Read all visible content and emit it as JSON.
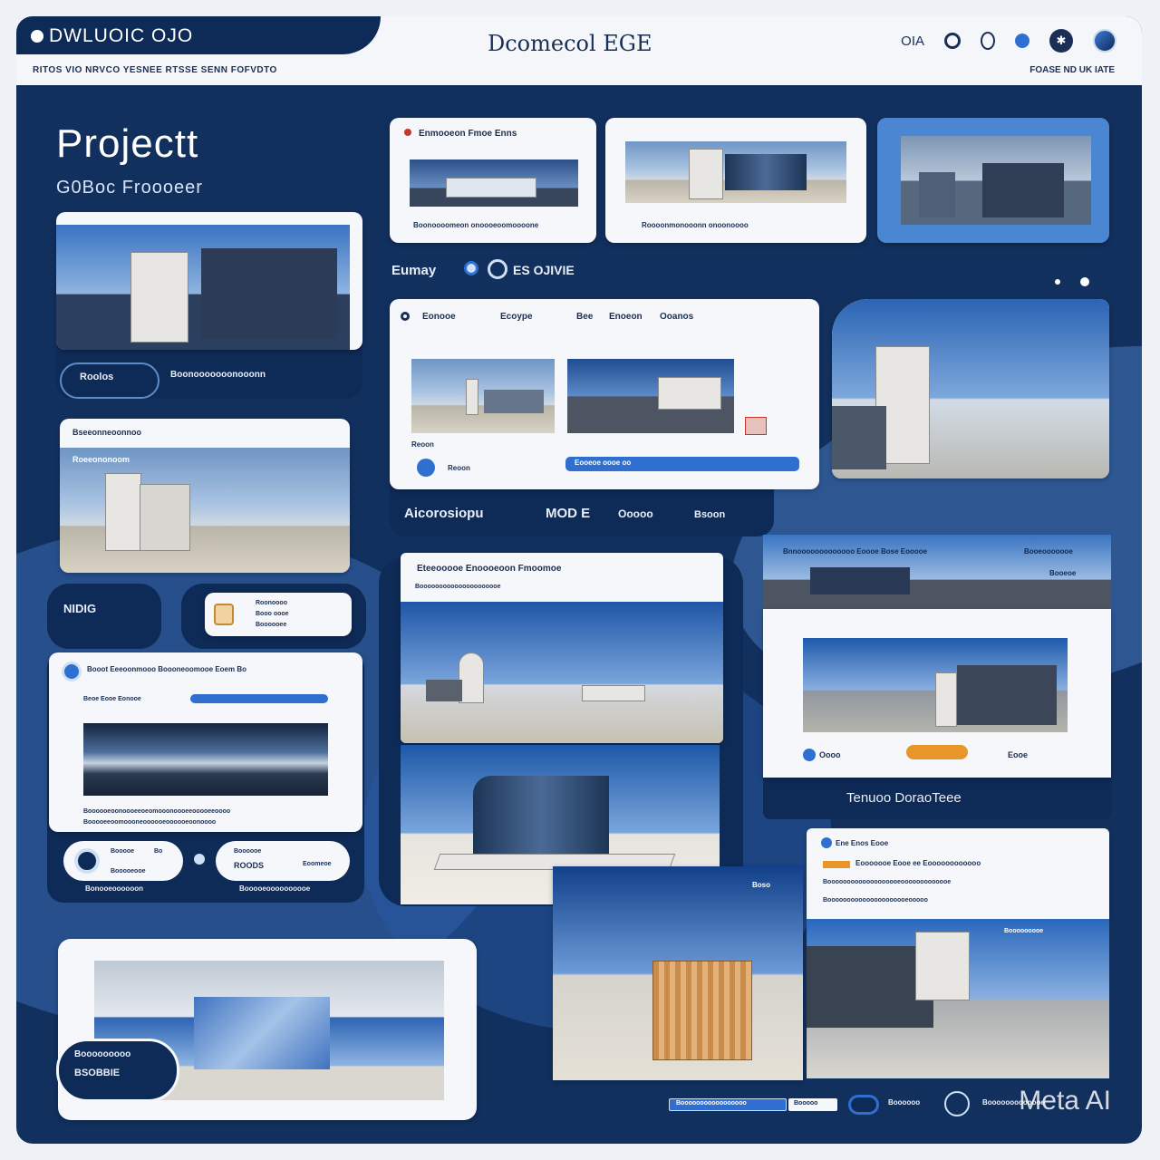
{
  "header": {
    "brand": "DWLUOIC  OJO",
    "nav": "RITOS VIO NRVCO YESNEE RTSSE SENN FOFVDTO",
    "title": "Dcomecol EGE",
    "icon_label": "OIA",
    "links": "FOASE ND UK IATE",
    "icons": [
      "user-icon",
      "circle-icon",
      "dot-icon",
      "globe-icon",
      "earth-icon"
    ]
  },
  "page": {
    "title": "Projectt",
    "subtitle": "G0Boc Froooeer"
  },
  "row_label": "Eumay",
  "row_label_icons": "ES OJIVIE",
  "cards": {
    "top1_title": "Enmooeon Fmoe Enns",
    "top1_caption": "Boonoooomeon onoooeoomoooone",
    "top2_caption": "Roooonmonooonn onoonoooo",
    "left1_caption": "Boonooooooonooonn",
    "left1_pill": "Roolos",
    "mid_tabs": [
      "Eonooe",
      "Ecoype",
      "Bee",
      "Enoeon",
      "Ooanos"
    ],
    "mid_caption": "Reoon",
    "mid_bar_text": "Eooeoe oooe oo",
    "mid_bottom": "Aicorosiopu",
    "mid_bottom_2": "MOD E",
    "mid_bottom_3": "Ooooo",
    "mid_bottom_4": "Bsoon",
    "left2_title": "Bseeonneoonnoo",
    "left2_sub": "Roeeononoom",
    "nido": "NIDIG",
    "chip_lines": [
      "Roonoooo",
      "Booo oooe",
      "Boooooee"
    ],
    "left3_title": "Booot Eeeoonmooo Boooneoomooe Eoem Bo",
    "left3_label": "Beoe Eooe Eonooe",
    "left3_lines": [
      "Boooooeoonoooeeoeomooonoooeeooooeeoooo",
      "Booooeeoomoooneoooooeoooooeoonoooo"
    ],
    "pill1_lines": [
      "Booooe",
      "Bo",
      "Booooeooe"
    ],
    "pill2_lines": [
      "Boooooe",
      "ROODS",
      "Eoomeoe"
    ],
    "pill_captions": [
      "Bonooeoooooon",
      "Booooeoooooooooe"
    ],
    "center_title": "Eteeooooe  Enoooeoon Fmoomoe",
    "center_sub": "Booooooooooooooooooooe",
    "right1_title": "Bnnooooooooooooo Eoooe Bose Eooooe",
    "right1_side": "Booeooooooe",
    "right1_side2": "Booeoe",
    "right1_foot_a": "Oooo",
    "right1_foot_b": "Eooe",
    "right1_bottom": "Tenuoo  DoraoTeee",
    "right2_title": "Ene Enos Eooe",
    "right2_sub": "Eooooooe Eooe ee Eoooooooooooo",
    "right2_lines": [
      "Booooooooooooooooooeooooooooooooe",
      "Booooooooooooooooooooeooooo"
    ],
    "right2_tag": "Booooooooe",
    "photo_label": "Boso",
    "bottom_left_lines": [
      "Booooooooo",
      "BSOBBIE"
    ],
    "footer_input": "Booooooooooooooooo",
    "footer_btn": "Booooo",
    "footer_text": "Boooooo",
    "footer_text2": "Booooooooooooe"
  },
  "watermark": "Meta AI",
  "colors": {
    "navy": "#0e2a56",
    "accent": "#2f6fd0",
    "orange": "#e8962a",
    "panel": "#f6f7fa"
  }
}
